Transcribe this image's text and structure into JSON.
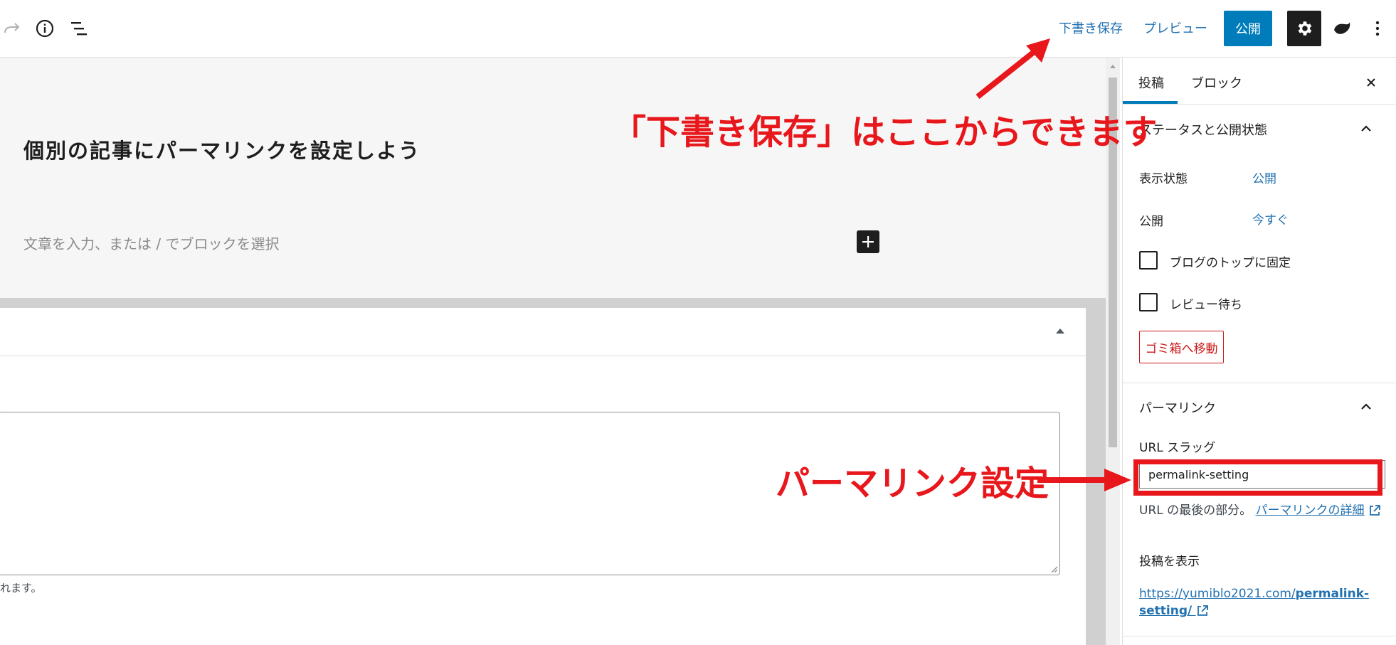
{
  "toolbar": {
    "save_draft_label": "下書き保存",
    "preview_label": "プレビュー",
    "publish_label": "公開",
    "icons": [
      "redo-icon",
      "info-icon",
      "list-view-icon",
      "gear-icon",
      "jetpack-icon",
      "more-vertical-icon"
    ]
  },
  "editor": {
    "title": "個別の記事にパーマリンクを設定しよう",
    "placeholder": "文章を入力、または / でブロックを選択",
    "meta_note": "れます。"
  },
  "sidebar": {
    "tabs": [
      {
        "label": "投稿",
        "active": true
      },
      {
        "label": "ブロック",
        "active": false
      }
    ],
    "status_panel": {
      "title": "ステータスと公開状態",
      "visibility_label": "表示状態",
      "visibility_value": "公開",
      "publish_label": "公開",
      "publish_value": "今すぐ",
      "sticky_label": "ブログのトップに固定",
      "pending_label": "レビュー待ち",
      "trash_label": "ゴミ箱へ移動"
    },
    "permalink_panel": {
      "title": "パーマリンク",
      "slug_label": "URL スラッグ",
      "slug_value": "permalink-setting",
      "help_prefix": "URL の最後の部分。",
      "help_link": "パーマリンクの詳細",
      "view_post_label": "投稿を表示",
      "view_url_prefix": "https://yumiblo2021.com/",
      "view_url_slug": "permalink-setting/"
    }
  },
  "annotations": {
    "save_draft_note": "「下書き保存」はここからできます",
    "permalink_note": "パーマリンク設定"
  },
  "colors": {
    "accent": "#007cba",
    "link": "#2271b1",
    "annotation": "#e8171c",
    "danger": "#cc1818"
  }
}
